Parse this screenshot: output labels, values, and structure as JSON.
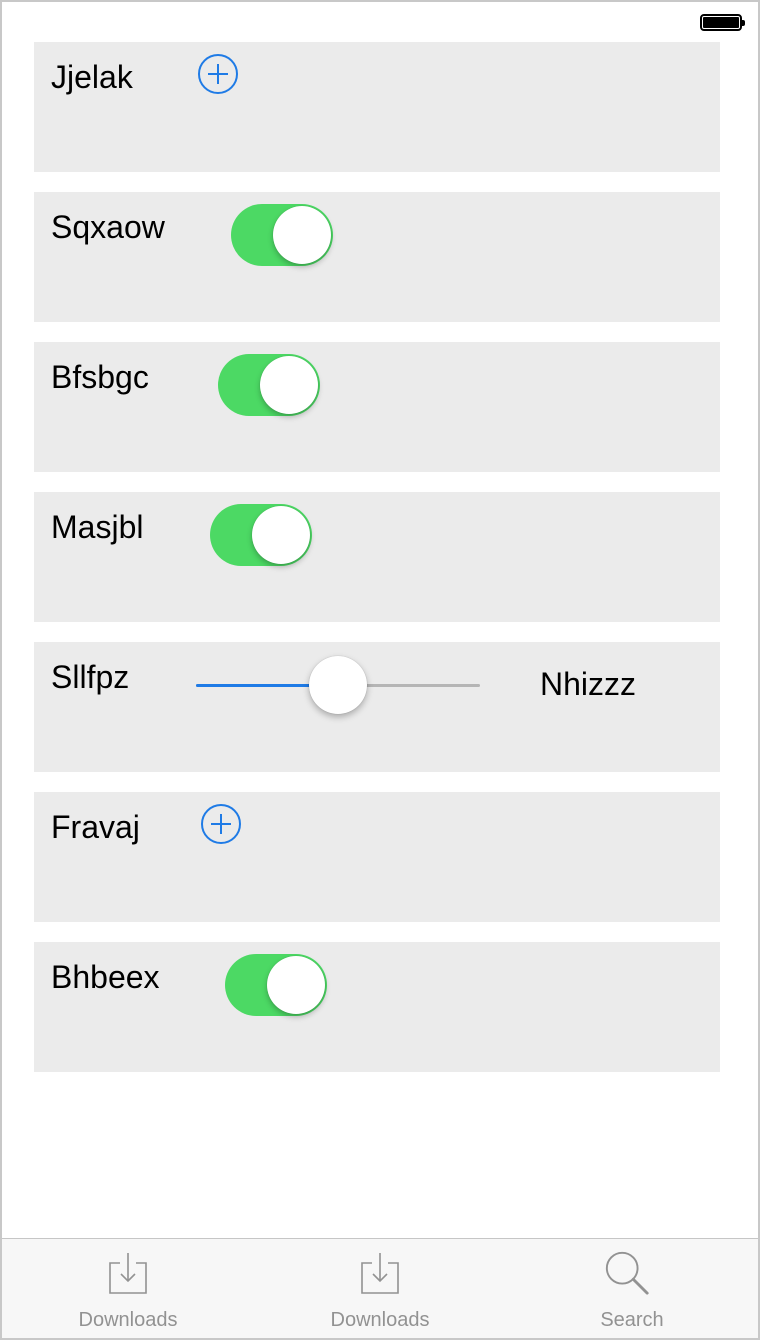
{
  "status_bar": {
    "battery_icon": "battery-full-icon"
  },
  "rows": [
    {
      "label": "Jjelak",
      "control": "add-button",
      "icon": "plus-circle-icon"
    },
    {
      "label": "Sqxaow",
      "control": "toggle",
      "state": "on"
    },
    {
      "label": "Bfsbgc",
      "control": "toggle",
      "state": "on"
    },
    {
      "label": "Masjbl",
      "control": "toggle",
      "state": "on"
    },
    {
      "label": "Sllfpz",
      "control": "slider",
      "value": 0.5,
      "right_label": "Nhizzz"
    },
    {
      "label": "Fravaj",
      "control": "add-button",
      "icon": "plus-circle-icon"
    },
    {
      "label": "Bhbeex",
      "control": "toggle",
      "state": "on"
    }
  ],
  "colors": {
    "accent_blue": "#1f7be6",
    "toggle_on_green": "#4cd964",
    "row_background": "#ebebeb",
    "tab_inactive": "#929292"
  },
  "tab_bar": {
    "items": [
      {
        "label": "Downloads",
        "icon": "download-tray-icon"
      },
      {
        "label": "Downloads",
        "icon": "download-tray-icon"
      },
      {
        "label": "Search",
        "icon": "magnifying-glass-icon"
      }
    ]
  }
}
